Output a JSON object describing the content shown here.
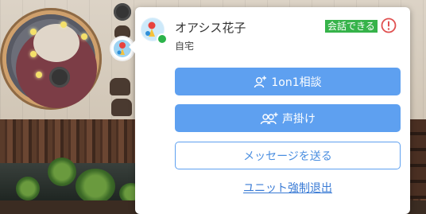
{
  "profile": {
    "name": "オアシス花子",
    "location": "自宅",
    "status_badge": "会話できる",
    "avatar_icon": "user-avatar-icon",
    "presence": "online",
    "presence_color": "#2bb34a"
  },
  "actions": {
    "consult_label": "1on1相談",
    "call_label": "声掛け",
    "message_label": "メッセージを送る",
    "exit_label": "ユニット強制退出"
  },
  "icons": {
    "consult": "user-plus-icon",
    "call": "users-plus-icon",
    "alert": "alert-circle-icon"
  },
  "colors": {
    "primary_button": "#5ea0f0",
    "badge_green": "#36b34a",
    "alert_red": "#e05050",
    "link_blue": "#3a7bd5"
  }
}
